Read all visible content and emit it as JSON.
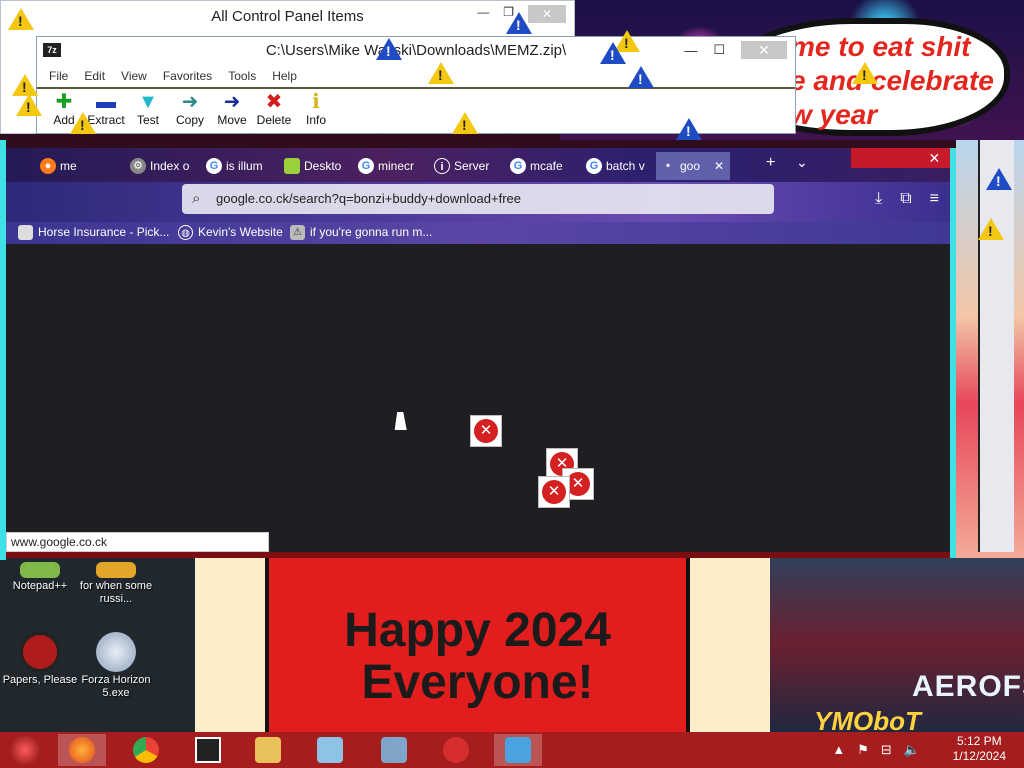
{
  "control_panel": {
    "title": "All Control Panel Items"
  },
  "zip": {
    "title": "C:\\Users\\Mike Waz",
    "title_rest": "ski\\Downloads\\MEMZ.zip\\",
    "app_icon": "7z",
    "menu": [
      "File",
      "Edit",
      "View",
      "Favorites",
      "Tools",
      "Help"
    ],
    "tools": [
      {
        "label": "Add",
        "icon": "plus-icon",
        "color": "#19a01e"
      },
      {
        "label": "Extract",
        "icon": "minus-icon",
        "color": "#1b3db8"
      },
      {
        "label": "Test",
        "icon": "checkmark-icon",
        "color": "#1fb8c8"
      },
      {
        "label": "Copy",
        "icon": "copy-arrow-icon",
        "color": "#2c8a8a"
      },
      {
        "label": "Move",
        "icon": "move-arrow-icon",
        "color": "#1b2f9a"
      },
      {
        "label": "Delete",
        "icon": "delete-x-icon",
        "color": "#d41c1c"
      },
      {
        "label": "Info",
        "icon": "info-icon",
        "color": "#d4b41c"
      }
    ]
  },
  "bubble": {
    "lines": [
      "me to eat shit",
      "e and celebrate",
      "w year"
    ]
  },
  "browser": {
    "tabs": [
      {
        "label": "me"
      },
      {
        "label": "Index o"
      },
      {
        "label": "is illum"
      },
      {
        "label": "Deskto"
      },
      {
        "label": "minecr"
      },
      {
        "label": "Server"
      },
      {
        "label": "mcafe"
      },
      {
        "label": "batch v"
      },
      {
        "label": "goo"
      }
    ],
    "url": "google.co.ck/search?q=bonzi+buddy+download+free",
    "bookmarks": [
      {
        "label": "Horse Insurance - Pick..."
      },
      {
        "label": "Kevin's Website"
      },
      {
        "label": "if you're gonna run m..."
      }
    ],
    "status_url": "www.google.co.ck"
  },
  "poster": {
    "line1": "Happy 2024",
    "line2": "Everyone!"
  },
  "city": {
    "sign": "AEROFS",
    "sign2": "YMOboT"
  },
  "desktop_icons": [
    {
      "label": "Notepad++",
      "color": "#7fb94a"
    },
    {
      "label": "for when some russi...",
      "color": "#e4a628"
    },
    {
      "label": "Papers, Please",
      "color": "#b01c1c"
    },
    {
      "label": "Forza Horizon 5.exe",
      "color": "#8aa0b8"
    }
  ],
  "taskbar": {
    "apps": [
      {
        "name": "firefox",
        "color": "#ff7a1a"
      },
      {
        "name": "chrome",
        "color": "#34a853"
      },
      {
        "name": "7zip",
        "color": "#222222"
      },
      {
        "name": "file-explorer",
        "color": "#e9c15a"
      },
      {
        "name": "notepad",
        "color": "#8fc3e6"
      },
      {
        "name": "task-manager",
        "color": "#7fa6c8"
      },
      {
        "name": "paint",
        "color": "#d62e2e"
      },
      {
        "name": "control-panel",
        "color": "#4aa3df"
      }
    ],
    "time": "5:12 PM",
    "date": "1/12/2024"
  }
}
